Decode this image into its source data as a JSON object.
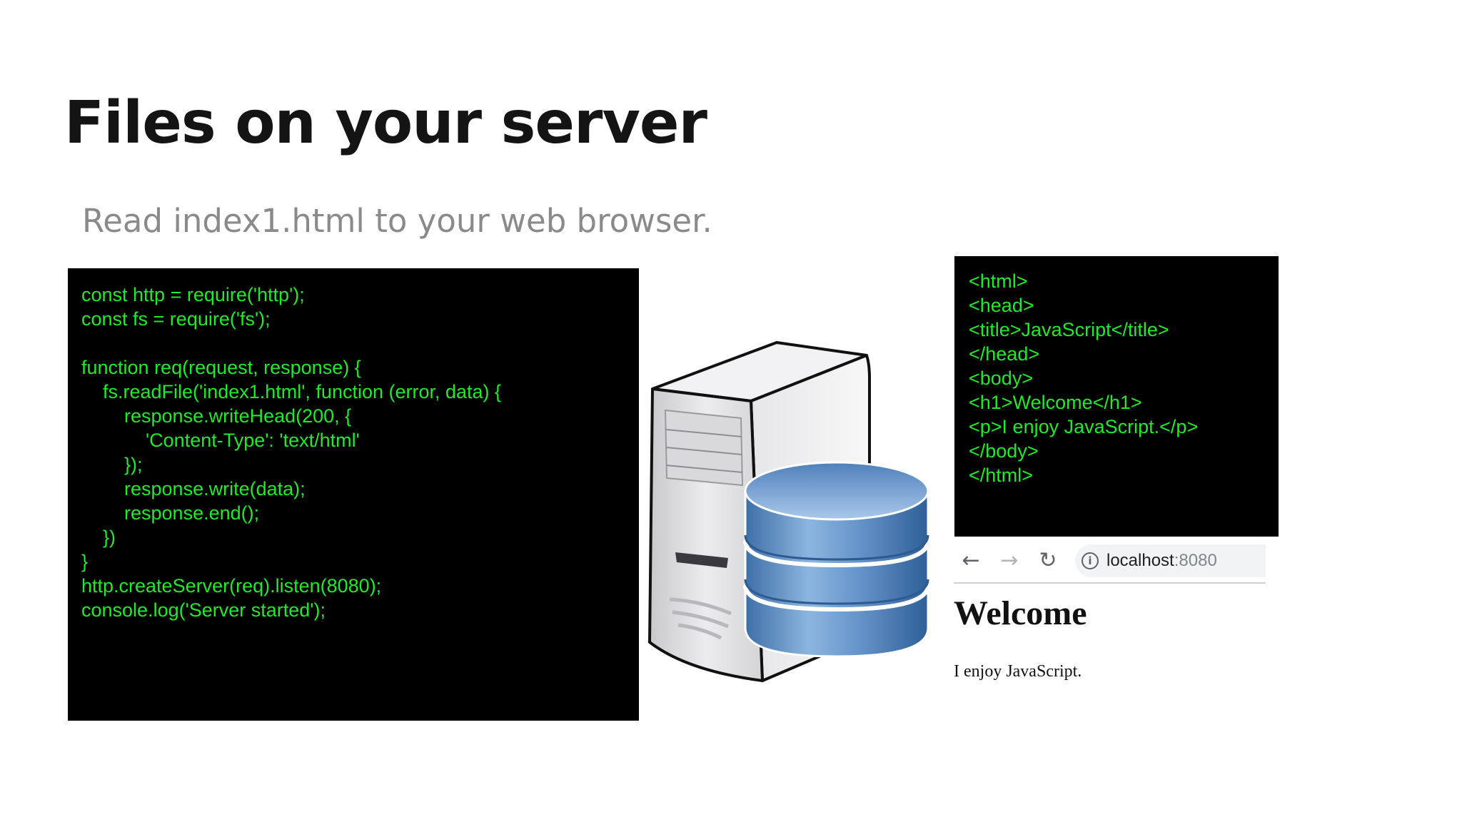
{
  "slide": {
    "title": "Files on your server",
    "subtitle": "Read index1.html to your web browser."
  },
  "server_code": [
    "const http = require('http');",
    "const fs = require('fs');",
    "",
    "function req(request, response) {",
    "    fs.readFile('index1.html', function (error, data) {",
    "        response.writeHead(200, {",
    "            'Content-Type': 'text/html'",
    "        });",
    "        response.write(data);",
    "        response.end();",
    "    })",
    "}",
    "http.createServer(req).listen(8080);",
    "console.log('Server started');"
  ],
  "html_code": [
    "<html>",
    "<head>",
    "<title>JavaScript</title>",
    "</head>",
    "<body>",
    "<h1>Welcome</h1>",
    "<p>I enjoy JavaScript.</p>",
    "</body>",
    "</html>"
  ],
  "browser": {
    "back_icon": "arrow-left",
    "forward_icon": "arrow-right",
    "reload_icon": "reload",
    "info_icon": "info-circle",
    "url_host": "localhost",
    "url_port": ":8080",
    "page_heading": "Welcome",
    "page_text": "I enjoy JavaScript."
  },
  "illustration": {
    "name": "server-with-database",
    "colors": {
      "code_bg": "#000000",
      "code_text": "#22e92b",
      "server_body": "#d9d9dc",
      "database": "#5b8fc7"
    }
  }
}
